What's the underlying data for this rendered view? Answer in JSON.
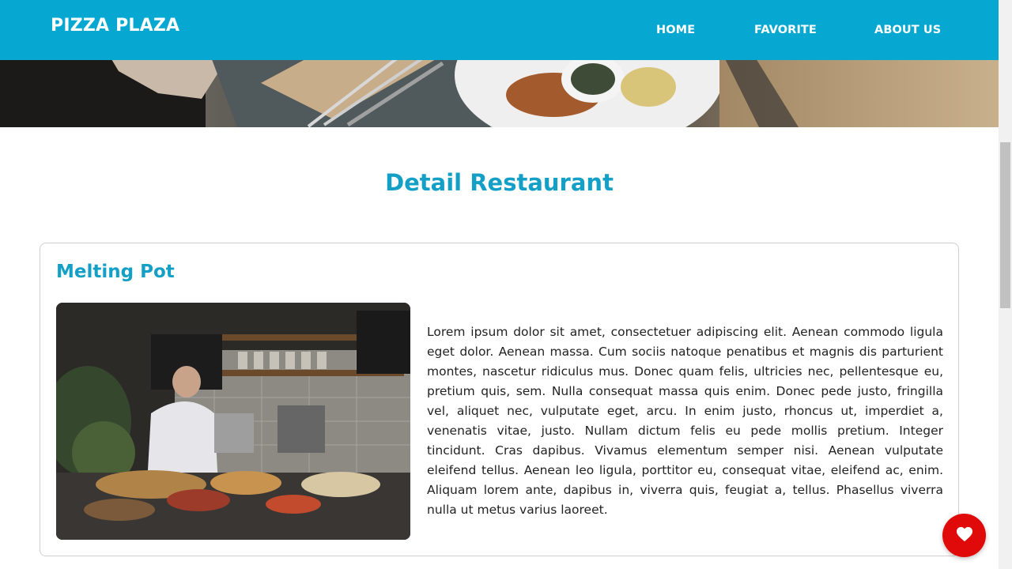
{
  "header": {
    "brand": "PIZZA PLAZA",
    "nav": [
      "HOME",
      "FAVORITE",
      "ABOUT US"
    ]
  },
  "main": {
    "title": "Detail Restaurant",
    "restaurant": {
      "name": "Melting Pot",
      "description": "Lorem ipsum dolor sit amet, consectetuer adipiscing elit. Aenean commodo ligula eget dolor. Aenean massa. Cum sociis natoque penatibus et magnis dis parturient montes, nascetur ridiculus mus. Donec quam felis, ultricies nec, pellentesque eu, pretium quis, sem. Nulla consequat massa quis enim. Donec pede justo, fringilla vel, aliquet nec, vulputate eget, arcu. In enim justo, rhoncus ut, imperdiet a, venenatis vitae, justo. Nullam dictum felis eu pede mollis pretium. Integer tincidunt. Cras dapibus. Vivamus elementum semper nisi. Aenean vulputate eleifend tellus. Aenean leo ligula, porttitor eu, consequat vitae, eleifend ac, enim. Aliquam lorem ante, dapibus in, viverra quis, feugiat a, tellus. Phasellus viverra nulla ut metus varius laoreet."
    }
  },
  "icons": {
    "favorite_button": "heart-icon"
  },
  "colors": {
    "primary": "#06a8d1",
    "heading": "#14a0c6",
    "favorite": "#e00a0a"
  }
}
